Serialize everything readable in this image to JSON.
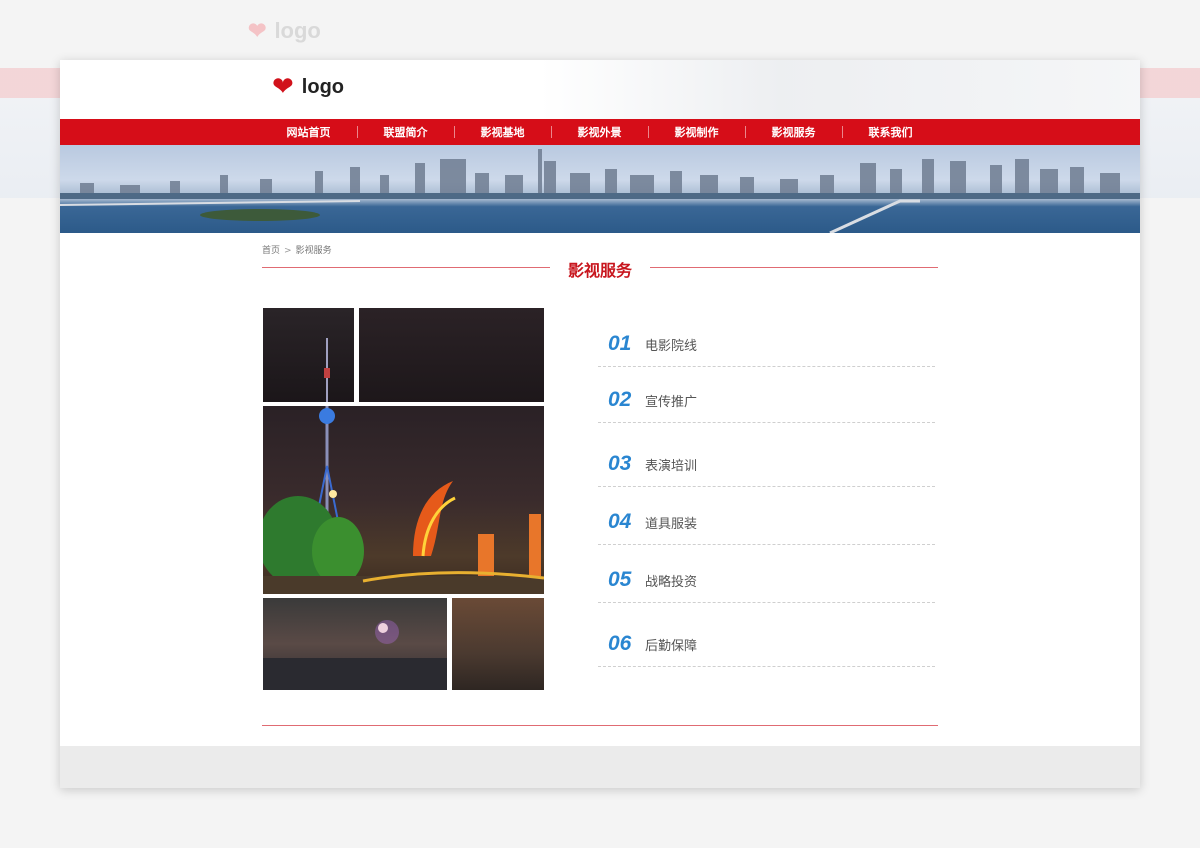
{
  "logo": {
    "text": "logo",
    "icon": "heart-icon"
  },
  "nav": {
    "items": [
      {
        "label": "网站首页"
      },
      {
        "label": "联盟简介"
      },
      {
        "label": "影视基地"
      },
      {
        "label": "影视外景"
      },
      {
        "label": "影视制作"
      },
      {
        "label": "影视服务"
      },
      {
        "label": "联系我们"
      }
    ]
  },
  "breadcrumb": {
    "home": "首页",
    "separator": ">",
    "current": "影视服务"
  },
  "section": {
    "title": "影视服务"
  },
  "services": [
    {
      "num": "01",
      "name": "电影院线"
    },
    {
      "num": "02",
      "name": "宣传推广"
    },
    {
      "num": "03",
      "name": "表演培训"
    },
    {
      "num": "04",
      "name": "道具服装"
    },
    {
      "num": "05",
      "name": "战略投资"
    },
    {
      "num": "06",
      "name": "后勤保障"
    }
  ],
  "colors": {
    "brand_red": "#d60d18",
    "accent_blue": "#2a86d1",
    "title_red": "#c8161e"
  }
}
